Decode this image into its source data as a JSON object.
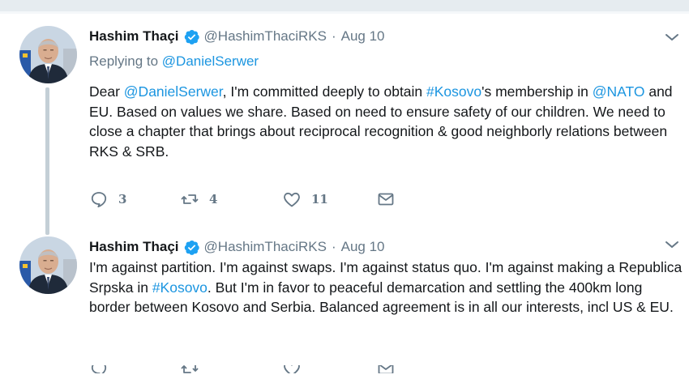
{
  "tweets": [
    {
      "author_name": "Hashim Thaçi",
      "author_handle": "@HashimThaciRKS",
      "separator": "·",
      "date": "Aug 10",
      "replying_label": "Replying to",
      "replying_handle": "@DanielSerwer",
      "text_parts": [
        "Dear ",
        "@DanielSerwer",
        ", I'm committed deeply to obtain ",
        "#Kosovo",
        "'s membership in ",
        "@NATO",
        " and EU. Based on values we share. Based on need to ensure safety of our children. We need to close a chapter that brings about reciprocal recognition & good neighborly relations between RKS & SRB."
      ],
      "counts": {
        "replies": "3",
        "retweets": "4",
        "likes": "11"
      }
    },
    {
      "author_name": "Hashim Thaçi",
      "author_handle": "@HashimThaciRKS",
      "separator": "·",
      "date": "Aug 10",
      "text_parts": [
        "I'm against partition. I'm against swaps. I'm against status quo. I'm against making a Republica Srpska in ",
        "#Kosovo",
        ". But I'm in favor to peaceful demarcation and settling the 400km long border between Kosovo and Serbia. Balanced agreement is in all our interests, incl US & EU."
      ]
    }
  ],
  "icons": {
    "verified": "verified-badge-icon",
    "more": "chevron-down-icon",
    "reply": "reply-icon",
    "retweet": "retweet-icon",
    "like": "heart-icon",
    "dm": "envelope-icon"
  },
  "colors": {
    "link": "#1b95e0",
    "secondary_text": "#657786",
    "primary_text": "#14171a",
    "thread_line": "#c4cfd6",
    "verified": "#1da1f2"
  }
}
